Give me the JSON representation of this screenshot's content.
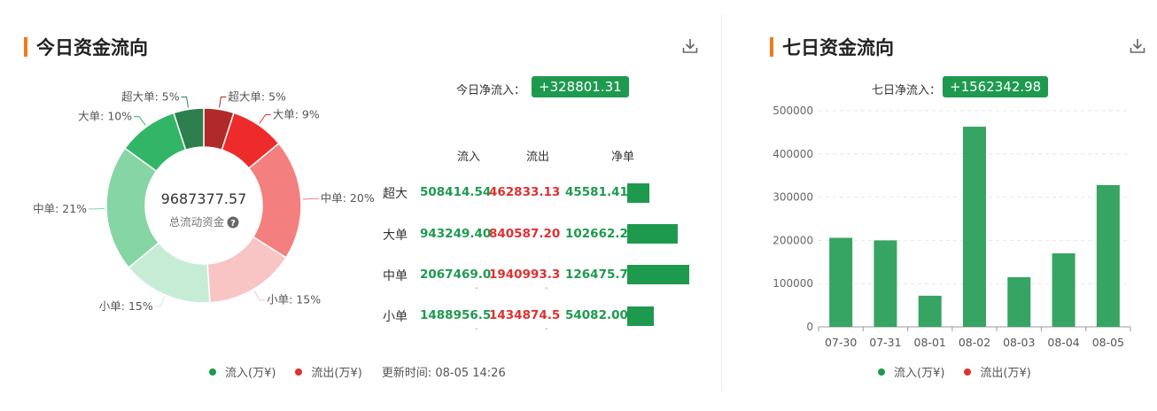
{
  "today": {
    "title": "今日资金流向",
    "net_label": "今日净流入：",
    "net_value": "+328801.31",
    "center_value": "9687377.57",
    "center_label": "总流动资金",
    "donut": [
      {
        "label": "超大单: 5%",
        "pct": 5,
        "color": "#b02a2a"
      },
      {
        "label": "大单: 9%",
        "pct": 9,
        "color": "#ee2b2b"
      },
      {
        "label": "中单: 20%",
        "pct": 20,
        "color": "#f47f7f"
      },
      {
        "label": "小单: 15%",
        "pct": 15,
        "color": "#f8c4c4"
      },
      {
        "label": "小单: 15%",
        "pct": 15,
        "color": "#c7ecd5"
      },
      {
        "label": "中单: 21%",
        "pct": 21,
        "color": "#86d5a4"
      },
      {
        "label": "大单: 10%",
        "pct": 10,
        "color": "#33b567"
      },
      {
        "label": "超大单: 5%",
        "pct": 5,
        "color": "#2d7f4e"
      }
    ],
    "table": {
      "headers": {
        "in": "流入",
        "out": "流出",
        "net": "净单"
      },
      "rows": [
        {
          "label": "超大",
          "in": "508414.54",
          "out": "462833.13",
          "net": "45581.41",
          "net_value": 45581.41
        },
        {
          "label": "大单",
          "in": "943249.40",
          "out": "840587.20",
          "net": "102662.2",
          "net_value": 102662.2
        },
        {
          "label": "中单",
          "in": "2067469.0",
          "out": "1940993.3",
          "net": "126475.7",
          "net_value": 126475.7
        },
        {
          "label": "小单",
          "in": "1488956.5",
          "out": "1434874.5",
          "net": "54082.00",
          "net_value": 54082.0
        }
      ],
      "dash": "-"
    },
    "legend": {
      "in": "流入(万¥)",
      "out": "流出(万¥)",
      "updated": "更新时间: 08-05 14:26"
    },
    "colors": {
      "in": "#1e9a4f",
      "out": "#e03030"
    }
  },
  "week": {
    "title": "七日资金流向",
    "net_label": "七日净流入：",
    "net_value": "+1562342.98",
    "legend": {
      "in": "流入(万¥)",
      "out": "流出(万¥)"
    }
  },
  "chart_data": {
    "type": "bar",
    "categories": [
      "07-30",
      "07-31",
      "08-01",
      "08-02",
      "08-03",
      "08-04",
      "08-05"
    ],
    "values": [
      206000,
      200000,
      72000,
      463000,
      115000,
      170000,
      328000
    ],
    "ylim": [
      0,
      500000
    ],
    "yticks": [
      0,
      100000,
      200000,
      300000,
      400000,
      500000
    ],
    "grid": true,
    "color": "#36a463"
  }
}
